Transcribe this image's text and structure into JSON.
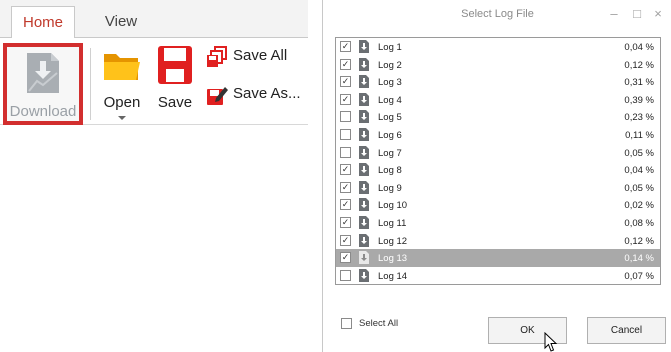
{
  "ribbon": {
    "tabs": [
      {
        "label": "Home",
        "active": true
      },
      {
        "label": "View",
        "active": false
      }
    ],
    "download_label": "Download",
    "open_label": "Open",
    "save_label": "Save",
    "save_all_label": "Save All",
    "save_as_label": "Save As...",
    "highlight_color": "#d22e2e",
    "folder_color": "#f5a800",
    "save_color": "#e02020"
  },
  "dialog": {
    "title": "Select Log File",
    "minimize_glyph": "–",
    "maximize_glyph": "□",
    "close_glyph": "×",
    "logs": [
      {
        "name": "Log 1",
        "percent": "0,04 %",
        "checked": true,
        "selected": false
      },
      {
        "name": "Log 2",
        "percent": "0,12 %",
        "checked": true,
        "selected": false
      },
      {
        "name": "Log 3",
        "percent": "0,31 %",
        "checked": true,
        "selected": false
      },
      {
        "name": "Log 4",
        "percent": "0,39 %",
        "checked": true,
        "selected": false
      },
      {
        "name": "Log 5",
        "percent": "0,23 %",
        "checked": false,
        "selected": false
      },
      {
        "name": "Log 6",
        "percent": "0,11 %",
        "checked": false,
        "selected": false
      },
      {
        "name": "Log 7",
        "percent": "0,05 %",
        "checked": false,
        "selected": false
      },
      {
        "name": "Log 8",
        "percent": "0,04 %",
        "checked": true,
        "selected": false
      },
      {
        "name": "Log 9",
        "percent": "0,05 %",
        "checked": true,
        "selected": false
      },
      {
        "name": "Log 10",
        "percent": "0,02 %",
        "checked": true,
        "selected": false
      },
      {
        "name": "Log 11",
        "percent": "0,08 %",
        "checked": true,
        "selected": false
      },
      {
        "name": "Log 12",
        "percent": "0,12 %",
        "checked": true,
        "selected": false
      },
      {
        "name": "Log 13",
        "percent": "0,14 %",
        "checked": true,
        "selected": true
      },
      {
        "name": "Log 14",
        "percent": "0,07 %",
        "checked": false,
        "selected": false
      }
    ],
    "select_all_label": "Select All",
    "select_all_checked": false,
    "ok_label": "OK",
    "cancel_label": "Cancel"
  }
}
